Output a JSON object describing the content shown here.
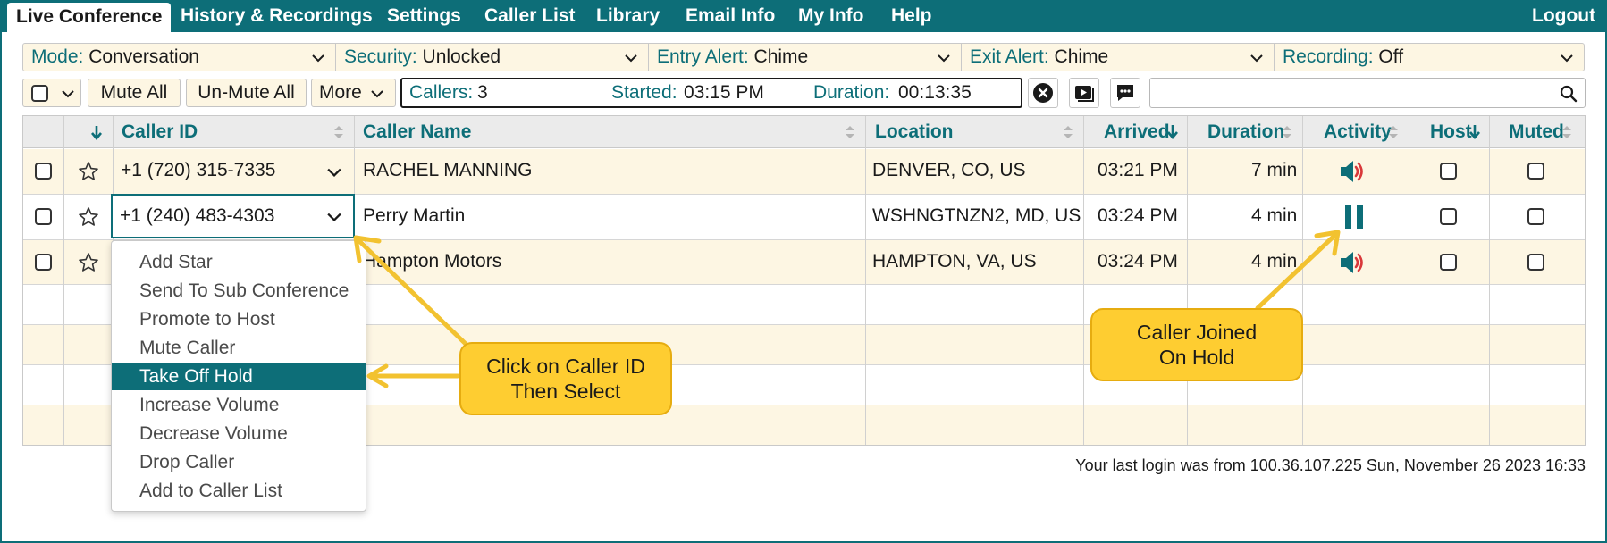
{
  "nav": {
    "tabs": [
      "Live Conference",
      "History & Recordings",
      "Settings",
      "Caller List",
      "Library",
      "Email Info",
      "My Info",
      "Help"
    ],
    "logout": "Logout"
  },
  "settings": [
    {
      "label": "Mode:",
      "value": "Conversation"
    },
    {
      "label": "Security:",
      "value": "Unlocked"
    },
    {
      "label": "Entry Alert:",
      "value": "Chime"
    },
    {
      "label": "Exit Alert:",
      "value": "Chime"
    },
    {
      "label": "Recording:",
      "value": "Off"
    }
  ],
  "toolbar": {
    "mute_all": "Mute All",
    "unmute_all": "Un-Mute All",
    "more": "More",
    "callers_label": "Callers:",
    "callers_value": "3",
    "started_label": "Started:",
    "started_value": "03:15 PM",
    "duration_label": "Duration:",
    "duration_value": "00:13:35",
    "search_value": ""
  },
  "table": {
    "columns": [
      "Caller ID",
      "Caller Name",
      "Location",
      "Arrived",
      "Duration",
      "Activity",
      "Host",
      "Muted"
    ],
    "rows": [
      {
        "caller_id": "+1 (720) 315-7335",
        "name": "RACHEL MANNING",
        "location": "DENVER, CO, US",
        "arrived": "03:21 PM",
        "duration": "7 min",
        "activity": "speaker"
      },
      {
        "caller_id": "+1 (240) 483-4303",
        "name": "Perry Martin",
        "location": "WSHNGTNZN2, MD, US",
        "arrived": "03:24 PM",
        "duration": "4 min",
        "activity": "pause"
      },
      {
        "caller_id": "",
        "name": "Hampton Motors",
        "location": "HAMPTON, VA, US",
        "arrived": "03:24 PM",
        "duration": "4 min",
        "activity": "speaker"
      }
    ]
  },
  "menu": {
    "items": [
      "Add Star",
      "Send To Sub Conference",
      "Promote to Host",
      "Mute Caller",
      "Take Off Hold",
      "Increase Volume",
      "Decrease Volume",
      "Drop Caller",
      "Add to Caller List"
    ],
    "selected": "Take Off Hold"
  },
  "callouts": {
    "left": [
      "Click on Caller ID",
      "Then Select"
    ],
    "right": [
      "Caller Joined",
      "On Hold"
    ]
  },
  "footer": "Your last login was from 100.36.107.225 Sun, November 26 2023 16:33",
  "colors": {
    "accent": "#0d6e78",
    "row_alt": "#fdf6e3",
    "callout": "#fecd31",
    "activity_red": "#d9383a"
  }
}
